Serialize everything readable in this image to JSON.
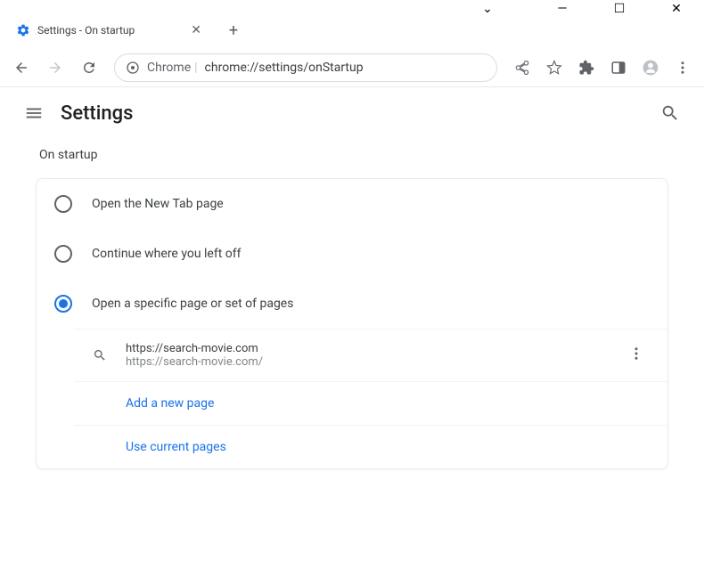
{
  "window": {
    "tab_title": "Settings - On startup"
  },
  "omnibox": {
    "prefix": "Chrome",
    "url": "chrome://settings/onStartup"
  },
  "header": {
    "title": "Settings"
  },
  "section": {
    "title": "On startup"
  },
  "options": {
    "new_tab": "Open the New Tab page",
    "continue": "Continue where you left off",
    "specific": "Open a specific page or set of pages"
  },
  "pages": [
    {
      "name": "https://search-movie.com",
      "url": "https://search-movie.com/"
    }
  ],
  "actions": {
    "add_page": "Add a new page",
    "use_current": "Use current pages"
  }
}
